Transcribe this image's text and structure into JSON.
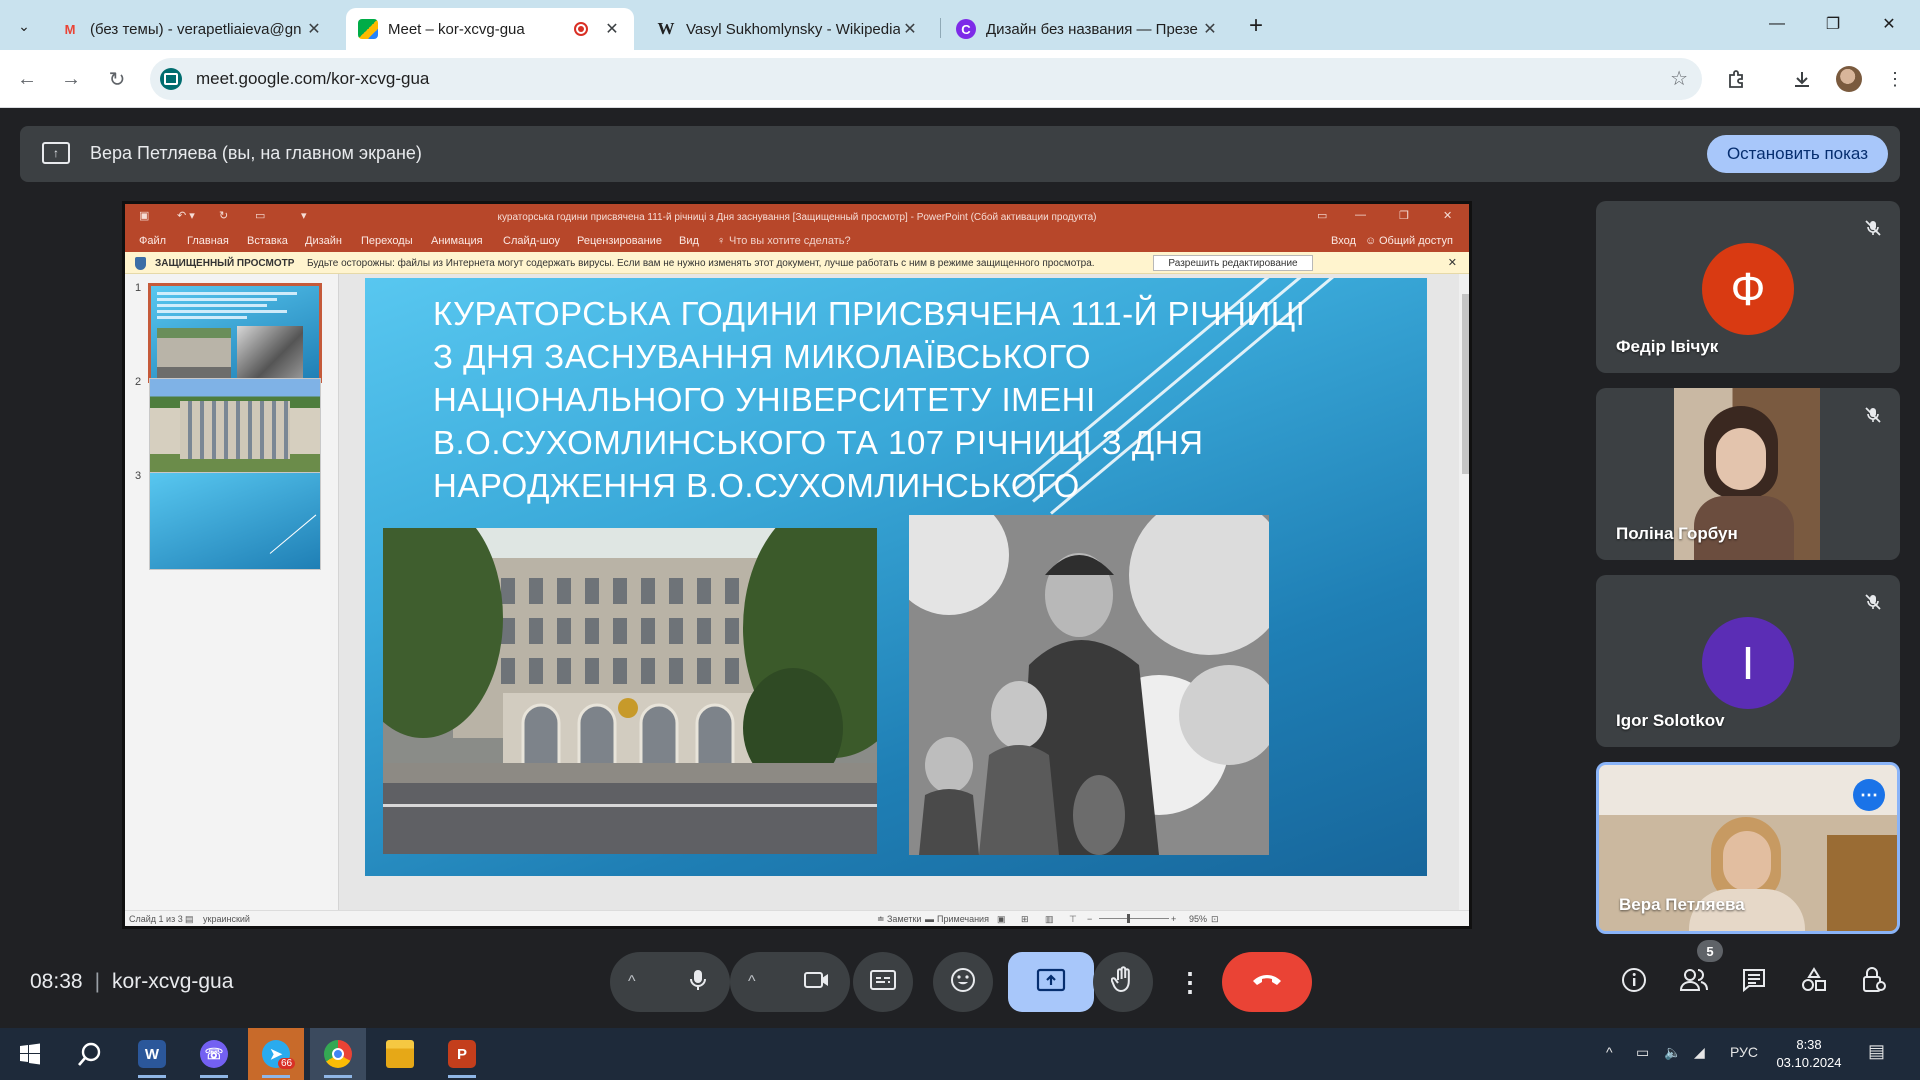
{
  "browser": {
    "tabs": [
      {
        "title": "(без темы) - verapetliaieva@gn",
        "favicon": "gmail-icon"
      },
      {
        "title": "Meet – kor-xcvg-gua",
        "favicon": "meet-icon",
        "active": true,
        "recording": true
      },
      {
        "title": "Vasyl Sukhomlynsky - Wikipedia",
        "favicon": "wikipedia-icon"
      },
      {
        "title": "Дизайн без названия — Презе",
        "favicon": "canva-icon"
      }
    ],
    "url": "meet.google.com/kor-xcvg-gua"
  },
  "meet": {
    "banner_text": "Вера Петляева (вы, на главном экране)",
    "stop_button": "Остановить показ",
    "time": "08:38",
    "meeting_code": "kor-xcvg-gua",
    "participants_count": "5",
    "participants": [
      {
        "name": "Федір Івічук",
        "initial": "Ф",
        "avatar_color": "#d93a12",
        "muted": true
      },
      {
        "name": "Поліна Горбун",
        "video": true,
        "muted": true
      },
      {
        "name": "Igor Solotkov",
        "initial": "I",
        "avatar_color": "#5b2db5",
        "muted": true
      },
      {
        "name": "Вера Петляева",
        "video": true,
        "self": true
      }
    ],
    "accent_colors": {
      "present": "#a8c7fa",
      "hangup": "#ea4335"
    }
  },
  "powerpoint": {
    "window_title": "кураторська години присвячена 111-й річниці з Дня заснування [Защищенный просмотр] - PowerPoint (Сбой активации продукта)",
    "ribbon_tabs": [
      "Файл",
      "Главная",
      "Вставка",
      "Дизайн",
      "Переходы",
      "Анимация",
      "Слайд-шоу",
      "Рецензирование",
      "Вид",
      "Что вы хотите сделать?"
    ],
    "sign_in": "Вход",
    "share": "Общий доступ",
    "protected_label": "ЗАЩИЩЕННЫЙ ПРОСМОТР",
    "protected_message": "Будьте осторожны: файлы из Интернета могут содержать вирусы. Если вам не нужно изменять этот документ, лучше работать с ним в режиме защищенного просмотра.",
    "enable_editing": "Разрешить редактирование",
    "thumb_numbers": [
      "1",
      "2",
      "3"
    ],
    "slide_title": "Кураторська години присвячена 111-й річниці з дня заснування Миколаївського національного університету імені В.О.Сухомлинського та 107 річниці з дня народження В.О.Сухомлинського",
    "status": {
      "slide_of": "Слайд 1 из 3",
      "language": "украинский",
      "notes": "Заметки",
      "comments": "Примечания",
      "zoom": "95%"
    }
  },
  "taskbar": {
    "telegram_badge": "66",
    "lang": "РУС",
    "time": "8:38",
    "date": "03.10.2024"
  }
}
